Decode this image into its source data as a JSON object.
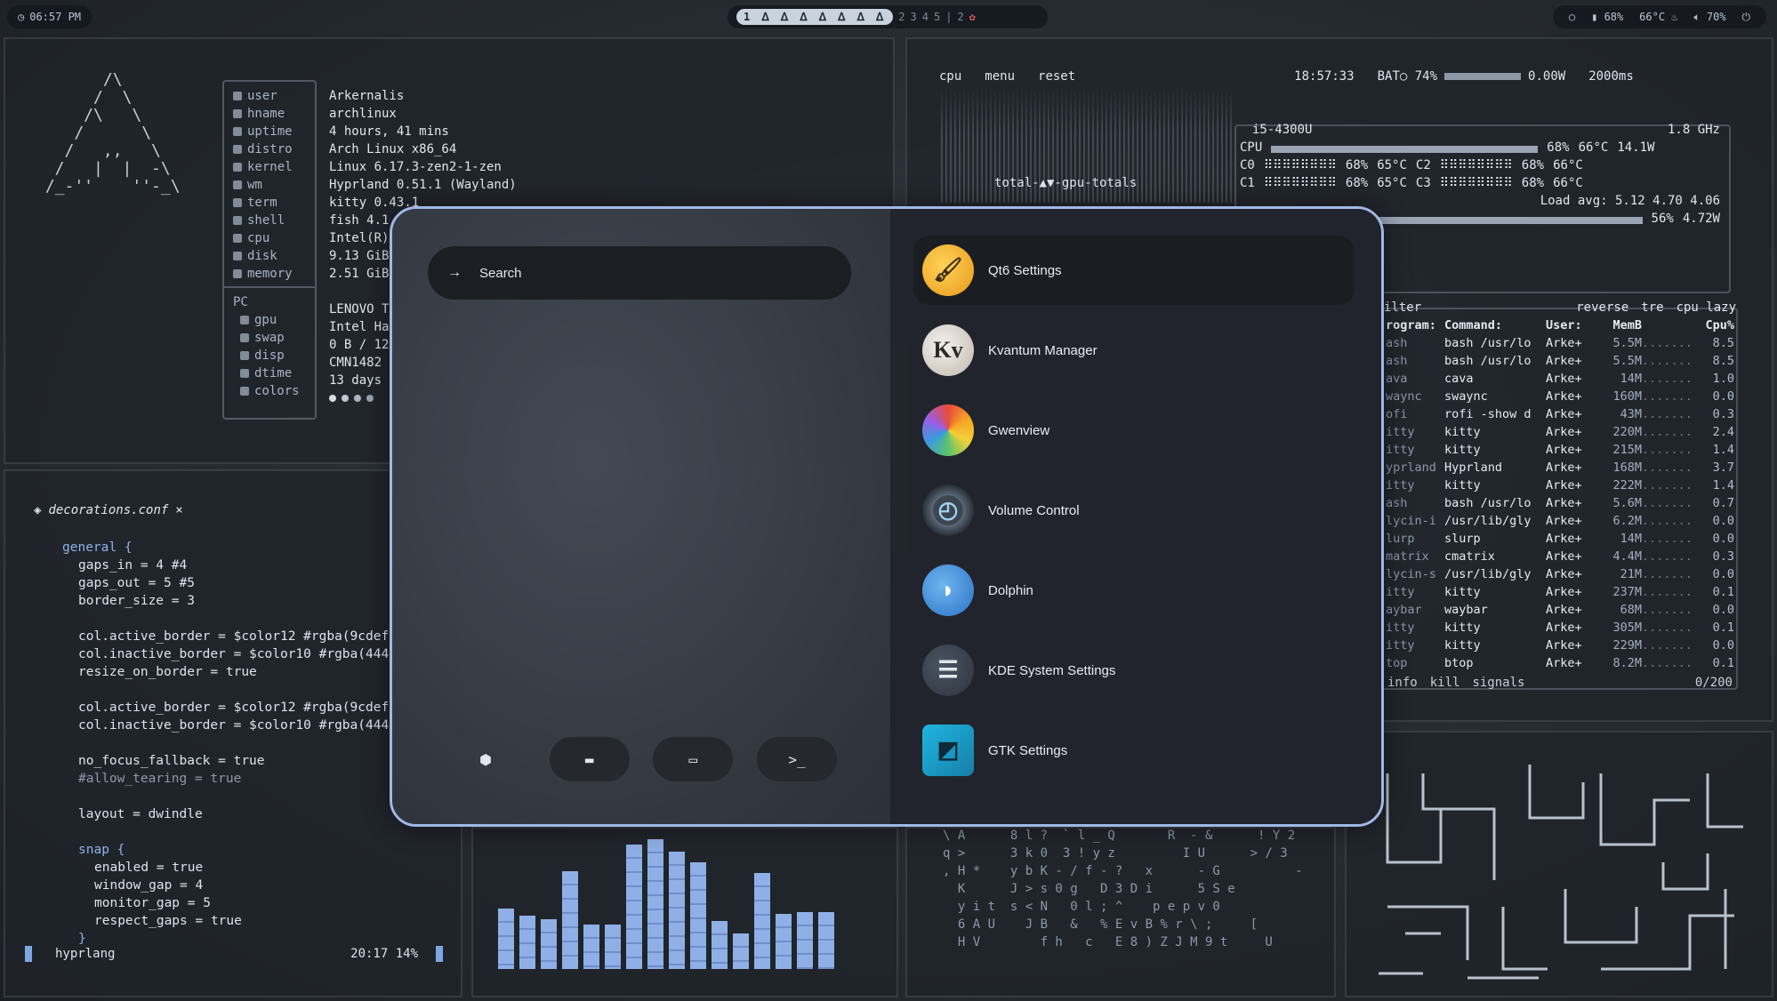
{
  "topbar": {
    "clock": "06:57 PM",
    "workspaces": [
      "1 ᐃ ᐃ ᐃ ᐃ ᐃ ᐃ ᐃ",
      "2",
      "3",
      "4",
      "5"
    ],
    "special": "2",
    "status": {
      "battery": "68%",
      "temp": "66°C",
      "volume": "70%"
    }
  },
  "fetch": {
    "keys": [
      "user",
      "hname",
      "uptime",
      "distro",
      "kernel",
      "wm",
      "term",
      "shell",
      "cpu",
      "disk",
      "memory"
    ],
    "values": [
      "Arkernalis",
      "archlinux",
      "4 hours, 41 mins",
      "Arch Linux x86_64",
      "Linux 6.17.3-zen2-1-zen",
      "Hyprland 0.51.1 (Wayland)",
      "kitty 0.43.1",
      "fish 4.1",
      "Intel(R)",
      "9.13 GiB",
      "2.51 GiB"
    ],
    "pc_label": "PC",
    "pc_keys": [
      "gpu",
      "swap",
      "disp",
      "dtime",
      "colors"
    ],
    "pc_values": [
      "LENOVO T",
      "Intel Ha",
      "0 B / 12",
      "CMN1482",
      "13 days"
    ]
  },
  "editor": {
    "filename": "decorations.conf",
    "close": "×",
    "lines": [
      {
        "t": "general {",
        "cls": "kw",
        "indent": 0
      },
      {
        "t": "gaps_in = 4 #4",
        "indent": 1
      },
      {
        "t": "gaps_out = 5 #5",
        "indent": 1
      },
      {
        "t": "border_size = 3",
        "indent": 1
      },
      {
        "t": "",
        "indent": 1
      },
      {
        "t": "col.active_border = $color12 #rgba(9cdef",
        "indent": 1
      },
      {
        "t": "col.inactive_border = $color10 #rgba(444",
        "indent": 1
      },
      {
        "t": "resize_on_border = true",
        "indent": 1
      },
      {
        "t": "",
        "indent": 1
      },
      {
        "t": "col.active_border = $color12 #rgba(9cdef",
        "indent": 1
      },
      {
        "t": "col.inactive_border = $color10 #rgba(444",
        "indent": 1
      },
      {
        "t": "",
        "indent": 1
      },
      {
        "t": "no_focus_fallback = true",
        "indent": 1
      },
      {
        "t": "#allow_tearing = true",
        "cls": "cm",
        "indent": 1
      },
      {
        "t": "",
        "indent": 1
      },
      {
        "t": "layout = dwindle",
        "indent": 1
      },
      {
        "t": "",
        "indent": 1
      },
      {
        "t": "snap {",
        "cls": "kw",
        "indent": 1
      },
      {
        "t": "enabled = true",
        "indent": 2
      },
      {
        "t": "window_gap = 4",
        "indent": 2
      },
      {
        "t": "monitor_gap = 5",
        "indent": 2
      },
      {
        "t": "respect_gaps = true",
        "indent": 2
      },
      {
        "t": "}",
        "cls": "kw",
        "indent": 1
      }
    ],
    "language": "hyprlang",
    "position": "20:17 14%"
  },
  "btop": {
    "tabs": [
      "cpu",
      "menu",
      "reset"
    ],
    "time": "18:57:33",
    "battery": "BAT○ 74%",
    "power": "0.00W",
    "interval": "2000ms",
    "gpu_label": "total-▲▼-gpu-totals",
    "cpu_model": "i5-4300U",
    "freq": "1.8 GHz",
    "cpu_pct": "68%",
    "cpu_temp": "66°C",
    "cpu_power": "14.1W",
    "cores": [
      {
        "name": "C0",
        "pct": "68%",
        "temp": "65°C",
        "name2": "C2",
        "pct2": "68%",
        "temp2": "66°C"
      },
      {
        "name": "C1",
        "pct": "68%",
        "temp": "65°C",
        "name2": "C3",
        "pct2": "68%",
        "temp2": "66°C"
      }
    ],
    "load_avg": "Load avg: 5.12 4.70 4.06",
    "gpu_pct": "56%",
    "gpu_power": "4.72W",
    "proc_head": [
      "ilter",
      "reverse",
      "tre",
      "cpu lazy"
    ],
    "proc_columns": [
      "rogram:",
      "Command:",
      "User:",
      "MemB",
      "Cpu%"
    ],
    "procs": [
      [
        "ash",
        "bash /usr/lo",
        "Arke+",
        "5.5M",
        "8.5"
      ],
      [
        "ash",
        "bash /usr/lo",
        "Arke+",
        "5.5M",
        "8.5"
      ],
      [
        "ava",
        "cava",
        "Arke+",
        "14M",
        "1.0"
      ],
      [
        "waync",
        "swaync",
        "Arke+",
        "160M",
        "0.0"
      ],
      [
        "ofi",
        "rofi -show d",
        "Arke+",
        "43M",
        "0.3"
      ],
      [
        "itty",
        "kitty",
        "Arke+",
        "220M",
        "2.4"
      ],
      [
        "itty",
        "kitty",
        "Arke+",
        "215M",
        "1.4"
      ],
      [
        "yprland",
        "Hyprland",
        "Arke+",
        "168M",
        "3.7"
      ],
      [
        "itty",
        "kitty",
        "Arke+",
        "222M",
        "1.4"
      ],
      [
        "ash",
        "bash /usr/lo",
        "Arke+",
        "5.6M",
        "0.7"
      ],
      [
        "lycin-i",
        "/usr/lib/gly",
        "Arke+",
        "6.2M",
        "0.0"
      ],
      [
        "lurp",
        "slurp",
        "Arke+",
        "14M",
        "0.0"
      ],
      [
        "matrix",
        "cmatrix",
        "Arke+",
        "4.4M",
        "0.3"
      ],
      [
        "lycin-s",
        "/usr/lib/gly",
        "Arke+",
        "21M",
        "0.0"
      ],
      [
        "itty",
        "kitty",
        "Arke+",
        "237M",
        "0.1"
      ],
      [
        "aybar",
        "waybar",
        "Arke+",
        "68M",
        "0.0"
      ],
      [
        "itty",
        "kitty",
        "Arke+",
        "305M",
        "0.1"
      ],
      [
        "itty",
        "kitty",
        "Arke+",
        "229M",
        "0.0"
      ],
      [
        "top",
        "btop",
        "Arke+",
        "8.2M",
        "0.1"
      ]
    ],
    "foot": [
      "info",
      "kill",
      "signals"
    ],
    "count": "0/200"
  },
  "cava": {
    "levels": [
      0.34,
      0.3,
      0.28,
      0.55,
      0.25,
      0.25,
      0.7,
      0.73,
      0.66,
      0.6,
      0.27,
      0.2,
      0.54,
      0.31,
      0.32,
      0.32
    ]
  },
  "matrix_text": "\\ A      8 l ?  ` l _ Q       R  - &      ! Y 2\nq >      3 k 0  3 ! y z         I U      > / 3\n, H *    y b K - / f - ?   x      - G          -\n  K      J > s 0 g   D 3 D i      5 S e\n  y i t  s < N   0 l ; ^    p e p v 0\n  6 A U    J B   &   % E v B % r \\ ;     [\n  H V        f h   c   E 8 ) Z J M 9 t     U",
  "launcher": {
    "search_placeholder": "Search",
    "search_arrow": "→",
    "apps": [
      {
        "name": "Qt6 Settings",
        "icon": "qt6-settings-icon"
      },
      {
        "name": "Kvantum Manager",
        "icon": "kvantum-icon"
      },
      {
        "name": "Gwenview",
        "icon": "gwenview-icon"
      },
      {
        "name": "Volume Control",
        "icon": "volume-control-icon"
      },
      {
        "name": "Dolphin",
        "icon": "dolphin-icon"
      },
      {
        "name": "KDE System Settings",
        "icon": "kde-settings-icon"
      },
      {
        "name": "GTK Settings",
        "icon": "gtk-settings-icon"
      }
    ],
    "modes": [
      "apps-mode",
      "files-mode",
      "windows-mode",
      "run-mode"
    ],
    "mode_glyphs": [
      "⬢",
      "▬",
      "▭",
      ">_"
    ],
    "kvantum_letter": "Kv"
  }
}
